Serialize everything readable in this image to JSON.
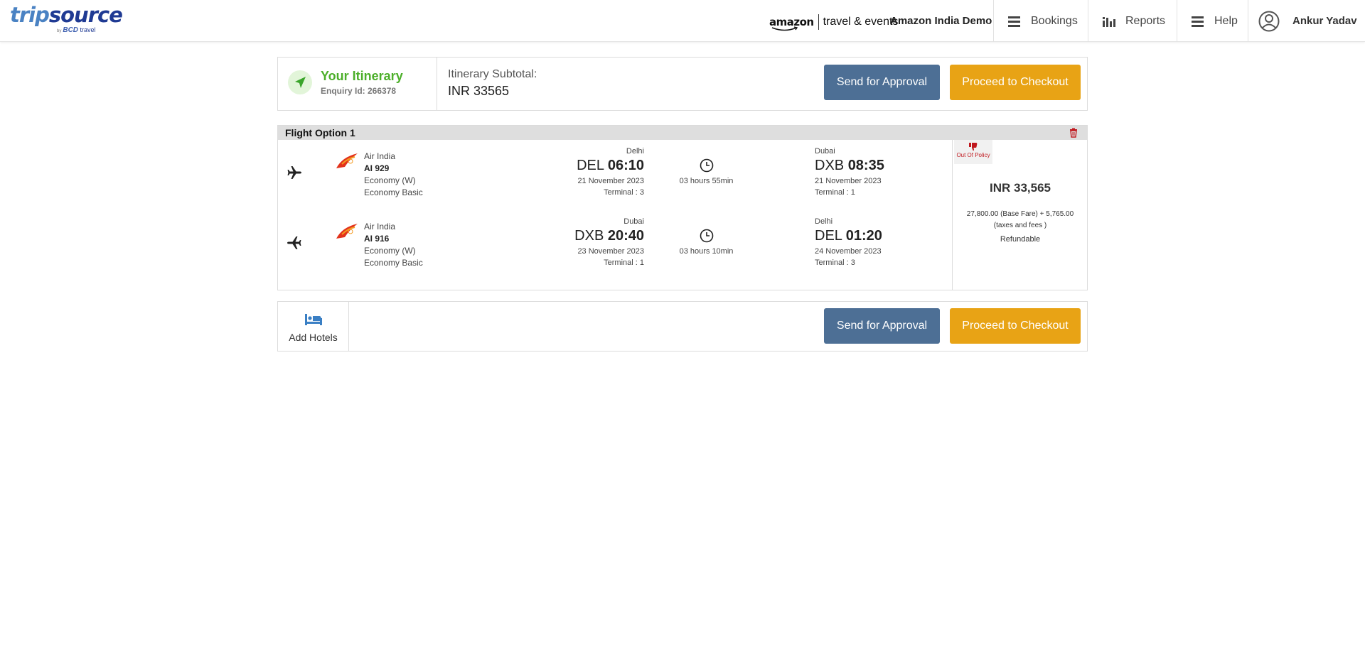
{
  "header": {
    "logo_main_a": "trip",
    "logo_main_b": "source",
    "logo_sub_by": "by",
    "logo_sub_brand": "BCD",
    "logo_sub_travel": "travel",
    "partner_word": "amazon",
    "partner_suffix": "travel & events",
    "company": "Amazon India Demo",
    "nav": {
      "bookings": "Bookings",
      "reports": "Reports",
      "help": "Help"
    },
    "user_name": "Ankur Yadav"
  },
  "itinerary": {
    "title": "Your Itinerary",
    "enquiry": "Enquiry Id: 266378",
    "subtotal_label": "Itinerary Subtotal:",
    "subtotal_value": "INR  33565",
    "send_approval": "Send for Approval",
    "checkout": "Proceed to Checkout"
  },
  "flight_option": {
    "title": "Flight Option 1",
    "legs": [
      {
        "airline": "Air India",
        "flight_no": "AI 929",
        "cabin": "Economy (W)",
        "fare": "Economy Basic",
        "dep_city": "Delhi",
        "dep_code": "DEL",
        "dep_time": "06:10",
        "dep_date": "21 November 2023",
        "dep_terminal": "Terminal : 3",
        "duration": "03 hours 55min",
        "arr_city": "Dubai",
        "arr_code": "DXB",
        "arr_time": "08:35",
        "arr_date": "21 November 2023",
        "arr_terminal": "Terminal : 1"
      },
      {
        "airline": "Air India",
        "flight_no": "AI 916",
        "cabin": "Economy (W)",
        "fare": "Economy Basic",
        "dep_city": "Dubai",
        "dep_code": "DXB",
        "dep_time": "20:40",
        "dep_date": "23 November 2023",
        "dep_terminal": "Terminal : 1",
        "duration": "03 hours 10min",
        "arr_city": "Delhi",
        "arr_code": "DEL",
        "arr_time": "01:20",
        "arr_date": "24 November 2023",
        "arr_terminal": "Terminal : 3"
      }
    ],
    "policy": "Out Of Policy",
    "price": "INR 33,565",
    "breakdown_line1": "27,800.00 (Base Fare) + 5,765.00",
    "breakdown_line2": "(taxes and fees )",
    "refundable": "Refundable"
  },
  "hotels": {
    "add_label": "Add Hotels",
    "send_approval": "Send for Approval",
    "checkout": "Proceed to Checkout"
  },
  "colors": {
    "approve_button": "#4d6f95",
    "checkout_button": "#e8a315",
    "itinerary_title": "#4caf2a",
    "policy_red": "#c0181e",
    "bed_icon": "#3a7fc4"
  }
}
